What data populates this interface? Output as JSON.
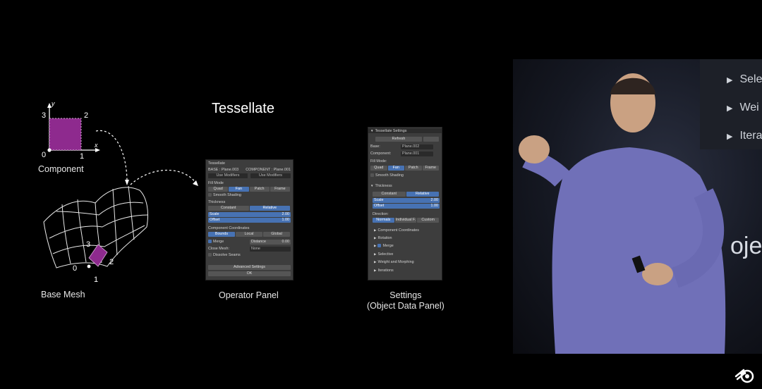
{
  "slide": {
    "title": "Tessellate",
    "captions": {
      "component": "Component",
      "base_mesh": "Base Mesh",
      "operator_panel": "Operator Panel",
      "settings_line1": "Settings",
      "settings_line2": "(Object Data Panel)"
    },
    "diagram": {
      "axis_y": "y",
      "axis_x": "x",
      "comp_3": "3",
      "comp_2": "2",
      "comp_0": "0",
      "comp_1": "1",
      "mesh_3": "3",
      "mesh_2": "2",
      "mesh_0": "0",
      "mesh_1": "1",
      "face_color": "#8e2a8e"
    }
  },
  "operator_panel": {
    "header": "Tessellate",
    "base_label": "BASE : Plane.003",
    "component_label": "COMPONENT : Plane.001",
    "use_modifiers_1": "Use Modifiers",
    "use_modifiers_2": "Use Modifiers",
    "fill_mode": "Fill Mode",
    "fill_options": [
      "Quad",
      "Fan",
      "Patch",
      "Frame"
    ],
    "smooth_shading": "Smooth Shading",
    "thickness": "Thickness",
    "thickness_options": [
      "Constant",
      "Relative"
    ],
    "scale_label": "Scale",
    "scale_value": "2.00",
    "offset_label": "Offset",
    "offset_value": "1.00",
    "component_coordinates": "Component Coordinates",
    "coord_options": [
      "Bounds",
      "Local",
      "Global"
    ],
    "merge": "Merge",
    "distance_label": "Distance",
    "distance_value": "0.00",
    "close_mesh_label": "Close Mesh:",
    "close_mesh_value": "None",
    "dissolve_seams": "Dissolve Seams",
    "advanced_settings": "Advanced Settings",
    "ok": "OK"
  },
  "settings_panel": {
    "header": "Tessellate Settings",
    "refresh": "Refresh",
    "base_label": "Base:",
    "base_value": "Plane.002",
    "component_label": "Component:",
    "component_value": "Plane.001",
    "fill_mode": "Fill Mode:",
    "fill_options": [
      "Quad",
      "Fan",
      "Patch",
      "Frame"
    ],
    "smooth_shading": "Smooth Shading",
    "thickness": "Thickness",
    "thickness_options": [
      "Constant",
      "Relative"
    ],
    "scale_label": "Scale",
    "scale_value": "2.00",
    "offset_label": "Offset",
    "offset_value": "1.00",
    "direction": "Direction:",
    "direction_options": [
      "Normals",
      "Individual F.",
      "Custom"
    ],
    "sections": [
      "Component Coordinates",
      "Rotation",
      "Merge",
      "Selective",
      "Weight and Morphing",
      "Iterations"
    ]
  },
  "stage_screen": {
    "items": [
      "Sele",
      "Wei",
      "Itera"
    ],
    "big_text": "oje"
  }
}
